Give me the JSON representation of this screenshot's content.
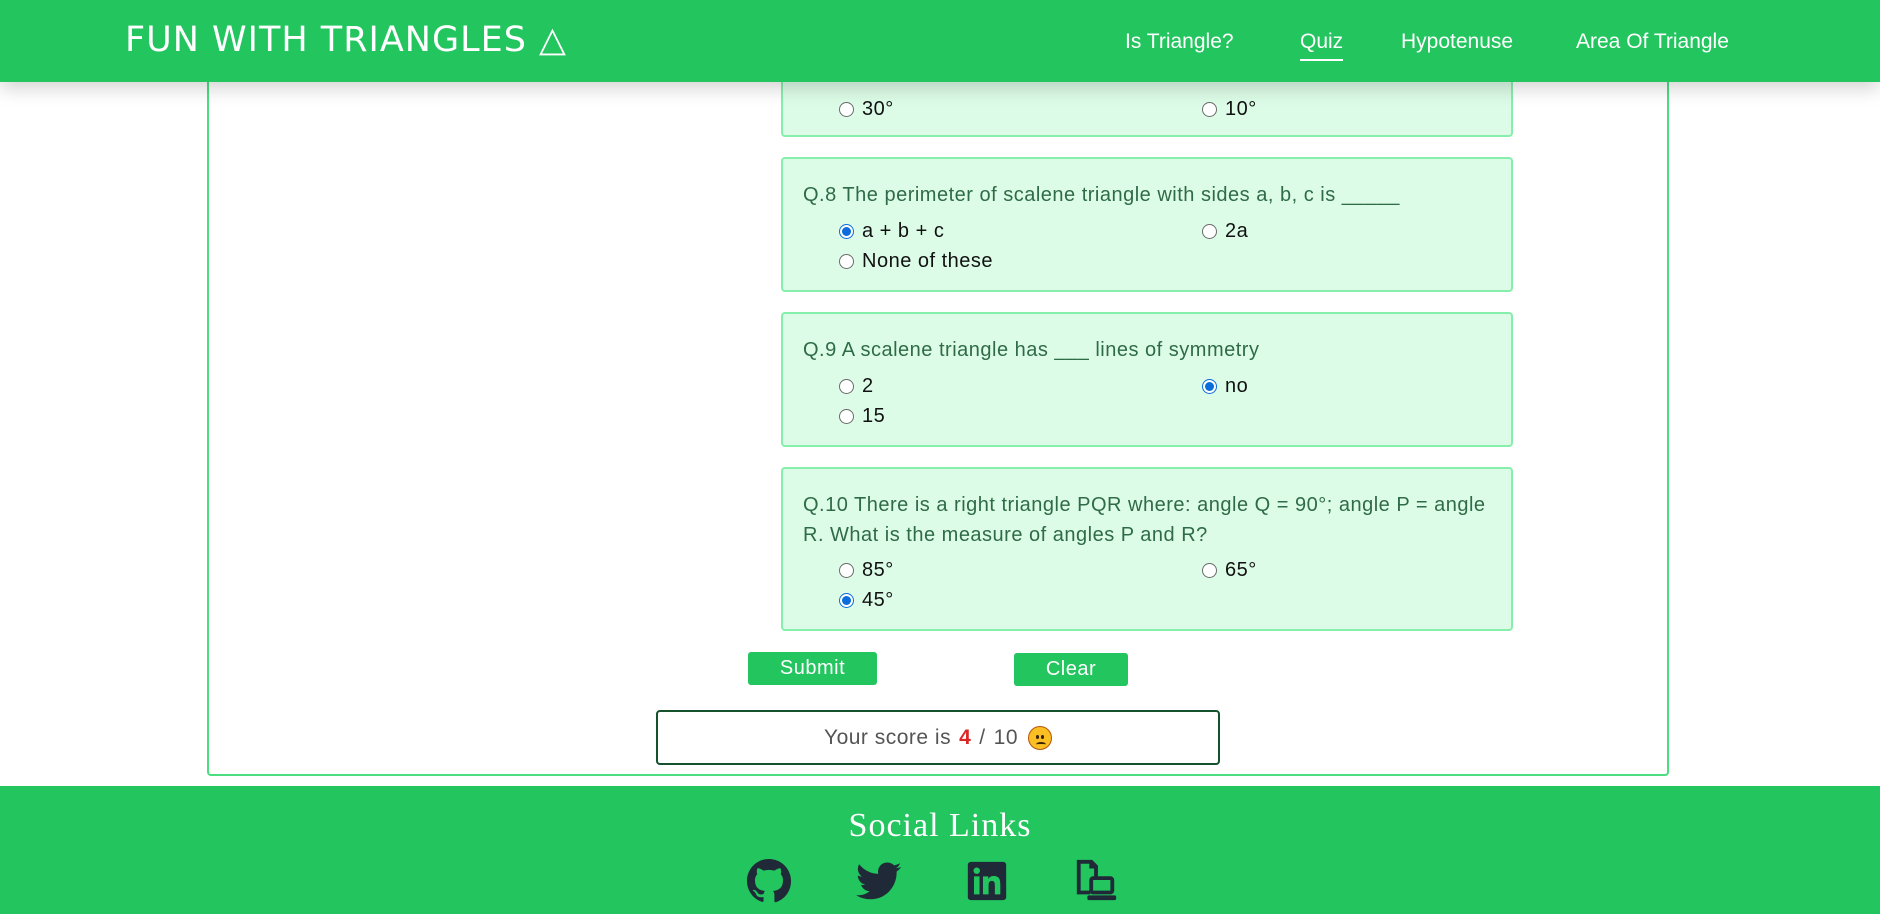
{
  "header": {
    "brand": "FUN WITH TRIANGLES △",
    "nav": [
      {
        "label": "Is Triangle?",
        "active": false
      },
      {
        "label": "Quiz",
        "active": true
      },
      {
        "label": "Hypotenuse",
        "active": false
      },
      {
        "label": "Area Of Triangle",
        "active": false
      }
    ]
  },
  "quiz": {
    "q7_partial": {
      "options": [
        {
          "label": "30°",
          "checked": false
        },
        {
          "label": "10°",
          "checked": false
        }
      ]
    },
    "q8": {
      "text": "Q.8 The perimeter of scalene triangle with sides a, b, c is _____",
      "options": [
        {
          "label": "a + b + c",
          "checked": true
        },
        {
          "label": "2a",
          "checked": false
        },
        {
          "label": "None of these",
          "checked": false
        }
      ]
    },
    "q9": {
      "text": "Q.9 A scalene triangle has ___ lines of symmetry",
      "options": [
        {
          "label": "2",
          "checked": false
        },
        {
          "label": "no",
          "checked": true
        },
        {
          "label": "15",
          "checked": false
        }
      ]
    },
    "q10": {
      "text": "Q.10 There is a right triangle PQR where: angle Q = 90°; angle P = angle R. What is the measure of angles P and R?",
      "options": [
        {
          "label": "85°",
          "checked": false
        },
        {
          "label": "65°",
          "checked": false
        },
        {
          "label": "45°",
          "checked": true
        }
      ]
    },
    "submit_label": "Submit",
    "clear_label": "Clear",
    "score": {
      "prefix": "Your score is",
      "value": "4",
      "separator": "/",
      "total": "10"
    }
  },
  "footer": {
    "title": "Social Links",
    "links": [
      "github-icon",
      "twitter-icon",
      "linkedin-icon",
      "portfolio-icon"
    ]
  },
  "colors": {
    "primary_green": "#22c55e",
    "question_bg": "#dcfce7",
    "question_border": "#86efac",
    "score_highlight": "#dc2626"
  }
}
